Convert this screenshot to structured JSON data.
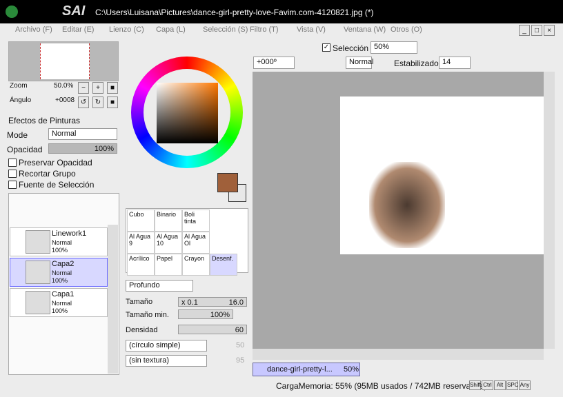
{
  "title": "C:\\Users\\Luisana\\Pictures\\dance-girl-pretty-love-Favim.com-4120821.jpg (*)",
  "app": "SAI",
  "menu": [
    "Archivo (F)",
    "Editar (E)",
    "Lienzo (C)",
    "Capa (L)",
    "Selección (S)",
    "Filtro (T)",
    "Vista (V)",
    "Ventana (W)",
    "Otros (O)"
  ],
  "nav": {
    "zoom_label": "Zoom",
    "zoom": "50.0%",
    "angle_label": "Ángulo",
    "angle": "+0008"
  },
  "effects": "Efectos de Pinturas",
  "mode_label": "Mode",
  "mode": "Normal",
  "opacity_label": "Opacidad",
  "opacity": "100%",
  "opacity_level": 1.0,
  "checks": [
    "Preservar Opacidad",
    "Recortar Grupo",
    "Fuente de Selección"
  ],
  "layers": [
    {
      "name": "Linework1",
      "mode": "Normal",
      "op": "100%"
    },
    {
      "name": "Capa2",
      "mode": "Normal",
      "op": "100%"
    },
    {
      "name": "Capa1",
      "mode": "Normal",
      "op": "100%"
    }
  ],
  "tools": [
    [
      "Cubo",
      "Binario",
      "Boli tinta"
    ],
    [
      "Al Agua 9",
      "Al Agua 10",
      "Al Agua Ol"
    ],
    [
      "Acrílico",
      "Papel",
      "Crayon",
      "Desenf."
    ]
  ],
  "brush": {
    "type": "Profundo",
    "size_label": "Tamaño",
    "size_mul": "x 0.1",
    "size": "16.0",
    "min_label": "Tamaño min.",
    "min": "100%",
    "dens_label": "Densidad",
    "dens": "60",
    "shape": "(círculo simple)",
    "shape_val": "50",
    "tex": "(sin textura)",
    "tex_val": "95"
  },
  "toolbar": {
    "sel": "Selección",
    "zoom": "50%",
    "angle": "+000º",
    "blend": "Normal",
    "stab_label": "Estabilizador",
    "stab": "14"
  },
  "doc_tab": {
    "name": "dance-girl-pretty-l...",
    "zoom": "50%"
  },
  "status": "CargaMemoria: 55% (95MB usados / 742MB reservados)",
  "keys": [
    "Shift",
    "Ctrl",
    "Alt",
    "SPC",
    "Any"
  ],
  "colors": {
    "fg": "#a0603a",
    "bg": "#e8e8e8"
  }
}
